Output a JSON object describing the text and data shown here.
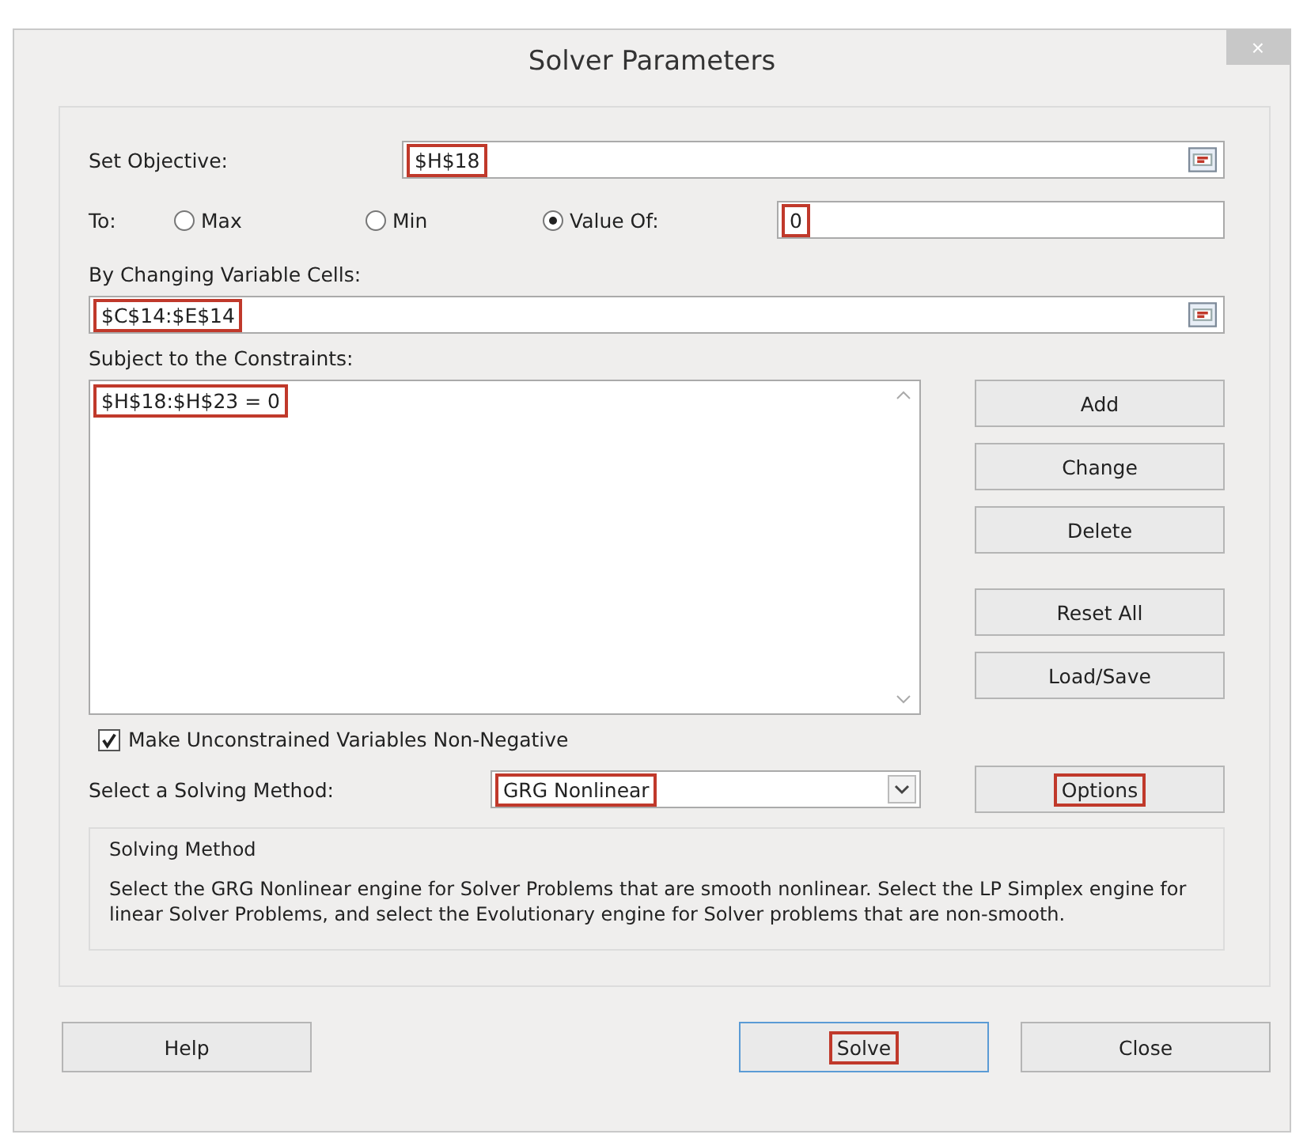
{
  "window": {
    "title": "Solver Parameters",
    "close": "×"
  },
  "objective": {
    "label": "Set Objective:",
    "value": "$H$18",
    "highlighted": true
  },
  "to": {
    "label": "To:",
    "options": [
      {
        "label": "Max",
        "selected": false
      },
      {
        "label": "Min",
        "selected": false
      },
      {
        "label": "Value Of:",
        "selected": true
      }
    ],
    "value": "0",
    "highlighted": true
  },
  "variable_cells": {
    "label": "By Changing Variable Cells:",
    "value": "$C$14:$E$14",
    "highlighted": true
  },
  "constraints": {
    "label": "Subject to the Constraints:",
    "items": [
      {
        "text": "$H$18:$H$23 = 0",
        "highlighted": true
      }
    ]
  },
  "side_buttons": [
    {
      "label": "Add",
      "highlighted": false
    },
    {
      "label": "Change",
      "highlighted": false
    },
    {
      "label": "Delete",
      "highlighted": false
    },
    {
      "label": "Reset All",
      "highlighted": false
    },
    {
      "label": "Load/Save",
      "highlighted": false
    }
  ],
  "nonnegative": {
    "label": "Make Unconstrained Variables Non-Negative",
    "checked": true
  },
  "method": {
    "label": "Select a Solving Method:",
    "value": "GRG Nonlinear",
    "highlighted": true
  },
  "options_button": {
    "label": "Options",
    "highlighted": true
  },
  "description": {
    "title": "Solving Method",
    "text": "Select the GRG Nonlinear engine for Solver Problems that are smooth nonlinear. Select the LP Simplex engine for linear Solver Problems, and select the Evolutionary engine for Solver problems that are non-smooth."
  },
  "bottom_buttons": [
    {
      "label": "Help",
      "highlighted": false,
      "selected": false
    },
    {
      "label": "Solve",
      "highlighted": true,
      "selected": true
    },
    {
      "label": "Close",
      "highlighted": false,
      "selected": false
    }
  ]
}
